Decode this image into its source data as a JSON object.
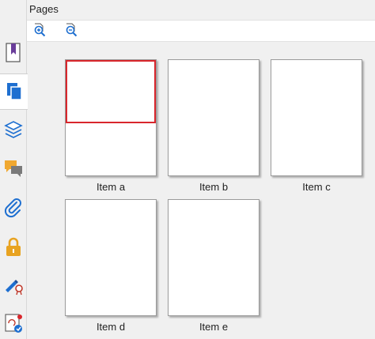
{
  "panel": {
    "title": "Pages"
  },
  "toolbar": {
    "buttons": [
      {
        "icon": "zoom-in-icon"
      },
      {
        "icon": "zoom-out-icon"
      }
    ]
  },
  "sidebar": {
    "items": [
      {
        "icon": "bookmark-icon",
        "active": false
      },
      {
        "icon": "pages-icon",
        "active": true
      },
      {
        "icon": "layers-icon",
        "active": false
      },
      {
        "icon": "comments-icon",
        "active": false
      },
      {
        "icon": "attachment-icon",
        "active": false
      },
      {
        "icon": "lock-icon",
        "active": false
      },
      {
        "icon": "signature-icon",
        "active": false
      },
      {
        "icon": "certificate-icon",
        "active": false
      }
    ]
  },
  "pages": [
    {
      "label": "Item a"
    },
    {
      "label": "Item b"
    },
    {
      "label": "Item c"
    },
    {
      "label": "Item d"
    },
    {
      "label": "Item e"
    }
  ],
  "colors": {
    "accent": "#1e6fd0",
    "selection": "#d9262c",
    "bookmark": "#6a3d9a",
    "comments": "#f0a830",
    "lock": "#e8a321"
  }
}
